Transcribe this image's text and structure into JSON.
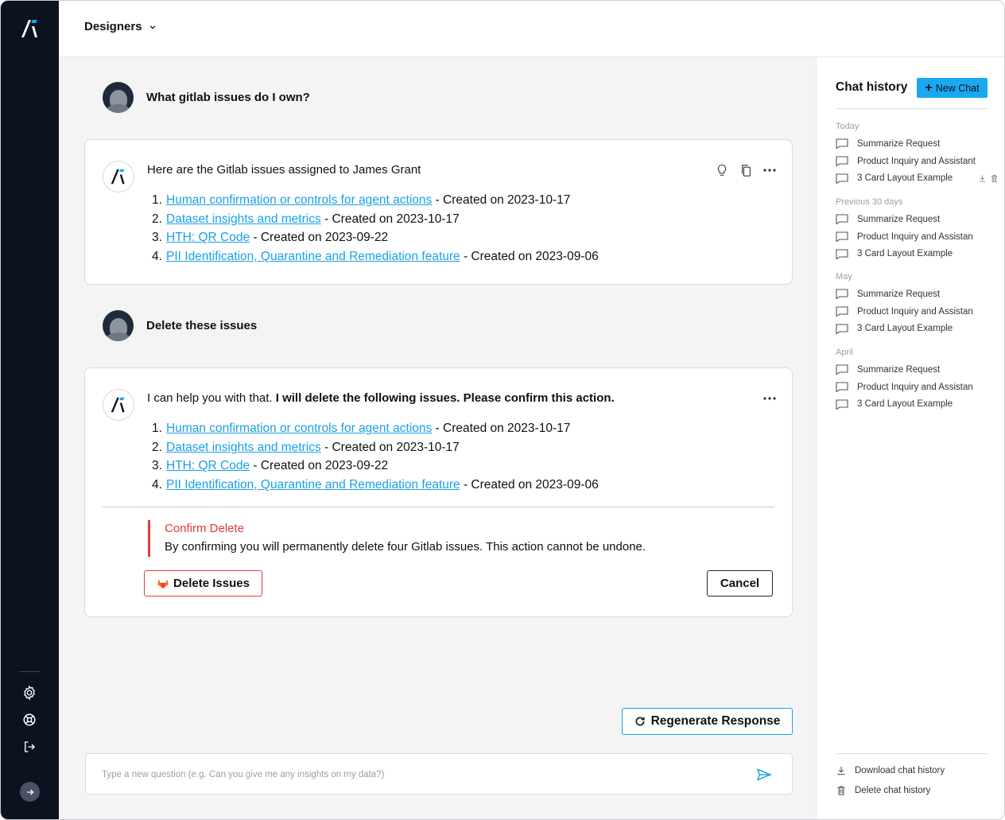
{
  "app": {
    "workspace": "Designers"
  },
  "conversation": {
    "messages": [
      {
        "role": "user",
        "text": "What gitlab issues do I own?"
      },
      {
        "role": "assistant",
        "lead": "Here are the Gitlab issues assigned to James Grant",
        "issues": [
          {
            "num": "1.",
            "title": "Human confirmation or controls for agent actions",
            "meta": " - Created on 2023-10-17"
          },
          {
            "num": "2.",
            "title": "Dataset insights and metrics",
            "meta": " - Created on 2023-10-17"
          },
          {
            "num": "3.",
            "title": "HTH: QR Code",
            "meta": " - Created on 2023-09-22"
          },
          {
            "num": "4.",
            "title": "PII Identification, Quarantine and Remediation feature",
            "meta": " - Created on 2023-09-06"
          }
        ]
      },
      {
        "role": "user",
        "text": "Delete these issues"
      },
      {
        "role": "assistant",
        "lead_plain": "I can help you with that. ",
        "lead_bold": "I will delete the following issues. Please confirm this action.",
        "issues": [
          {
            "num": "1.",
            "title": "Human confirmation or controls for agent actions",
            "meta": " - Created on 2023-10-17"
          },
          {
            "num": "2.",
            "title": "Dataset insights and metrics",
            "meta": " - Created on 2023-10-17"
          },
          {
            "num": "3.",
            "title": "HTH: QR Code",
            "meta": " - Created on 2023-09-22"
          },
          {
            "num": "4.",
            "title": "PII Identification, Quarantine and Remediation feature",
            "meta": " - Created on 2023-09-06"
          }
        ],
        "confirm": {
          "title": "Confirm Delete",
          "text": "By confirming you will permanently delete four Gitlab issues. This action cannot be undone.",
          "delete_label": "Delete Issues",
          "cancel_label": "Cancel"
        }
      }
    ],
    "regenerate_label": "Regenerate Response",
    "input_placeholder": "Type a new question (e.g. Can you give me any insights on my data?)"
  },
  "history": {
    "title": "Chat history",
    "new_chat_label": "New Chat",
    "groups": [
      {
        "label": "Today",
        "items": [
          "Summarize Request",
          "Product Inquiry and Assistant",
          "3 Card Layout Example"
        ]
      },
      {
        "label": "Previous 30 days",
        "items": [
          "Summarize Request",
          "Product Inquiry and Assistan",
          "3 Card Layout Example"
        ]
      },
      {
        "label": "May",
        "items": [
          "Summarize Request",
          "Product Inquiry and Assistan",
          "3 Card Layout Example"
        ]
      },
      {
        "label": "April",
        "items": [
          "Summarize Request",
          "Product Inquiry and Assistan",
          "3 Card Layout Example"
        ]
      }
    ],
    "download_label": "Download chat history",
    "delete_label": "Delete chat history"
  },
  "icons": {
    "rail": [
      "gear-icon",
      "lifebuoy-icon",
      "logout-icon",
      "arrow-right-icon"
    ],
    "message_tools": [
      "lightbulb-icon",
      "copy-icon",
      "more-icon"
    ]
  },
  "colors": {
    "rail_bg": "#0b1220",
    "accent": "#1aa8f0",
    "link": "#1aa0e6",
    "danger": "#e03b3b"
  }
}
